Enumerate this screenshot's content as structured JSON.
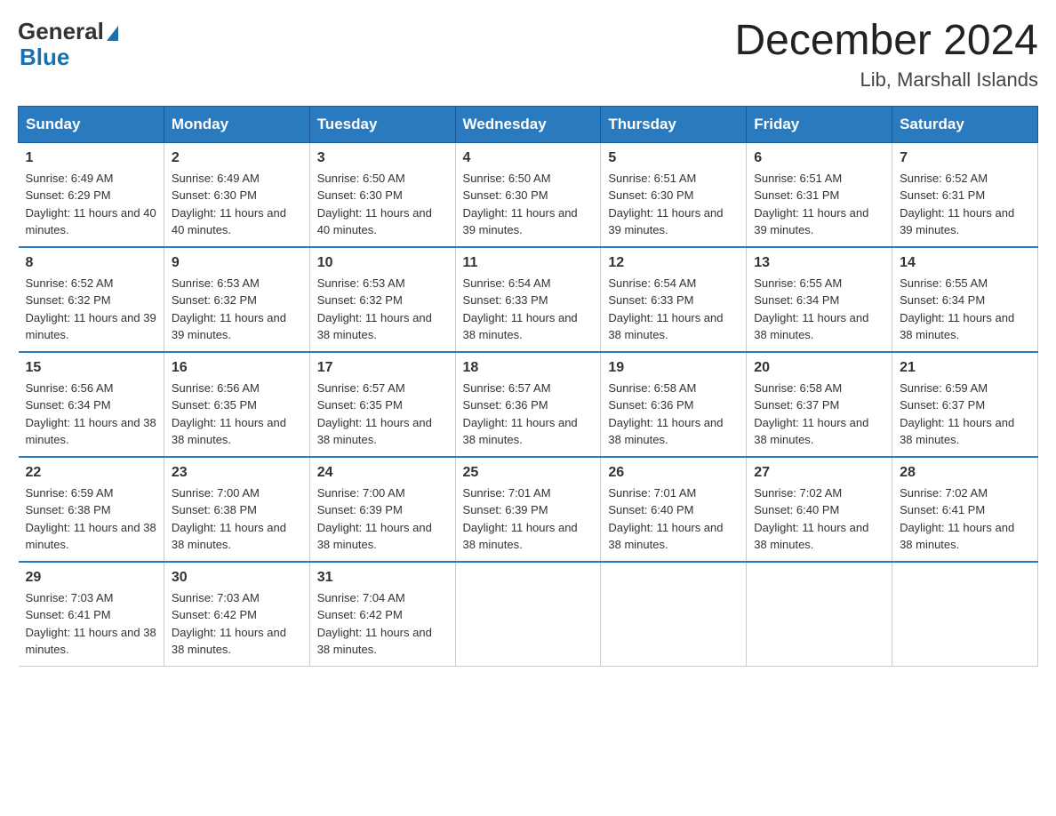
{
  "header": {
    "logo_general": "General",
    "logo_blue": "Blue",
    "title": "December 2024",
    "subtitle": "Lib, Marshall Islands"
  },
  "days_of_week": [
    "Sunday",
    "Monday",
    "Tuesday",
    "Wednesday",
    "Thursday",
    "Friday",
    "Saturday"
  ],
  "weeks": [
    [
      {
        "day": "1",
        "sunrise": "6:49 AM",
        "sunset": "6:29 PM",
        "daylight": "11 hours and 40 minutes."
      },
      {
        "day": "2",
        "sunrise": "6:49 AM",
        "sunset": "6:30 PM",
        "daylight": "11 hours and 40 minutes."
      },
      {
        "day": "3",
        "sunrise": "6:50 AM",
        "sunset": "6:30 PM",
        "daylight": "11 hours and 40 minutes."
      },
      {
        "day": "4",
        "sunrise": "6:50 AM",
        "sunset": "6:30 PM",
        "daylight": "11 hours and 39 minutes."
      },
      {
        "day": "5",
        "sunrise": "6:51 AM",
        "sunset": "6:30 PM",
        "daylight": "11 hours and 39 minutes."
      },
      {
        "day": "6",
        "sunrise": "6:51 AM",
        "sunset": "6:31 PM",
        "daylight": "11 hours and 39 minutes."
      },
      {
        "day": "7",
        "sunrise": "6:52 AM",
        "sunset": "6:31 PM",
        "daylight": "11 hours and 39 minutes."
      }
    ],
    [
      {
        "day": "8",
        "sunrise": "6:52 AM",
        "sunset": "6:32 PM",
        "daylight": "11 hours and 39 minutes."
      },
      {
        "day": "9",
        "sunrise": "6:53 AM",
        "sunset": "6:32 PM",
        "daylight": "11 hours and 39 minutes."
      },
      {
        "day": "10",
        "sunrise": "6:53 AM",
        "sunset": "6:32 PM",
        "daylight": "11 hours and 38 minutes."
      },
      {
        "day": "11",
        "sunrise": "6:54 AM",
        "sunset": "6:33 PM",
        "daylight": "11 hours and 38 minutes."
      },
      {
        "day": "12",
        "sunrise": "6:54 AM",
        "sunset": "6:33 PM",
        "daylight": "11 hours and 38 minutes."
      },
      {
        "day": "13",
        "sunrise": "6:55 AM",
        "sunset": "6:34 PM",
        "daylight": "11 hours and 38 minutes."
      },
      {
        "day": "14",
        "sunrise": "6:55 AM",
        "sunset": "6:34 PM",
        "daylight": "11 hours and 38 minutes."
      }
    ],
    [
      {
        "day": "15",
        "sunrise": "6:56 AM",
        "sunset": "6:34 PM",
        "daylight": "11 hours and 38 minutes."
      },
      {
        "day": "16",
        "sunrise": "6:56 AM",
        "sunset": "6:35 PM",
        "daylight": "11 hours and 38 minutes."
      },
      {
        "day": "17",
        "sunrise": "6:57 AM",
        "sunset": "6:35 PM",
        "daylight": "11 hours and 38 minutes."
      },
      {
        "day": "18",
        "sunrise": "6:57 AM",
        "sunset": "6:36 PM",
        "daylight": "11 hours and 38 minutes."
      },
      {
        "day": "19",
        "sunrise": "6:58 AM",
        "sunset": "6:36 PM",
        "daylight": "11 hours and 38 minutes."
      },
      {
        "day": "20",
        "sunrise": "6:58 AM",
        "sunset": "6:37 PM",
        "daylight": "11 hours and 38 minutes."
      },
      {
        "day": "21",
        "sunrise": "6:59 AM",
        "sunset": "6:37 PM",
        "daylight": "11 hours and 38 minutes."
      }
    ],
    [
      {
        "day": "22",
        "sunrise": "6:59 AM",
        "sunset": "6:38 PM",
        "daylight": "11 hours and 38 minutes."
      },
      {
        "day": "23",
        "sunrise": "7:00 AM",
        "sunset": "6:38 PM",
        "daylight": "11 hours and 38 minutes."
      },
      {
        "day": "24",
        "sunrise": "7:00 AM",
        "sunset": "6:39 PM",
        "daylight": "11 hours and 38 minutes."
      },
      {
        "day": "25",
        "sunrise": "7:01 AM",
        "sunset": "6:39 PM",
        "daylight": "11 hours and 38 minutes."
      },
      {
        "day": "26",
        "sunrise": "7:01 AM",
        "sunset": "6:40 PM",
        "daylight": "11 hours and 38 minutes."
      },
      {
        "day": "27",
        "sunrise": "7:02 AM",
        "sunset": "6:40 PM",
        "daylight": "11 hours and 38 minutes."
      },
      {
        "day": "28",
        "sunrise": "7:02 AM",
        "sunset": "6:41 PM",
        "daylight": "11 hours and 38 minutes."
      }
    ],
    [
      {
        "day": "29",
        "sunrise": "7:03 AM",
        "sunset": "6:41 PM",
        "daylight": "11 hours and 38 minutes."
      },
      {
        "day": "30",
        "sunrise": "7:03 AM",
        "sunset": "6:42 PM",
        "daylight": "11 hours and 38 minutes."
      },
      {
        "day": "31",
        "sunrise": "7:04 AM",
        "sunset": "6:42 PM",
        "daylight": "11 hours and 38 minutes."
      },
      null,
      null,
      null,
      null
    ]
  ]
}
